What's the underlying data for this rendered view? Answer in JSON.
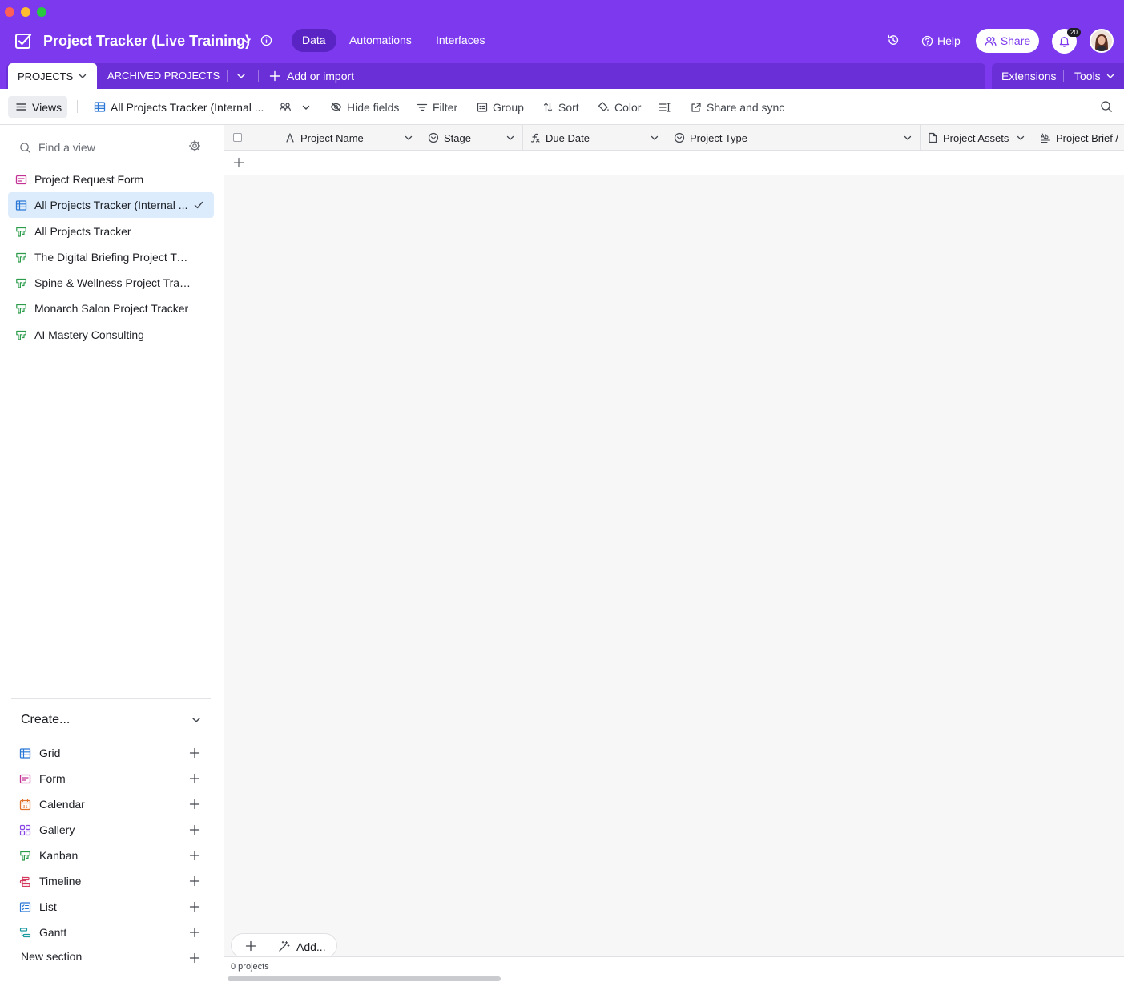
{
  "base": {
    "title": "Project Tracker (Live Training)",
    "brand_color": "#7c39ed"
  },
  "top_tabs": [
    "Data",
    "Automations",
    "Interfaces"
  ],
  "header_actions": {
    "help": "Help",
    "share": "Share",
    "notifications_count": "20"
  },
  "tables": {
    "active": "PROJECTS",
    "other": "ARCHIVED PROJECTS",
    "add_import": "Add or import",
    "extensions": "Extensions",
    "tools": "Tools"
  },
  "toolbar": {
    "views": "Views",
    "current_view": "All Projects Tracker (Internal ...",
    "hide_fields": "Hide fields",
    "filter": "Filter",
    "group": "Group",
    "sort": "Sort",
    "color": "Color",
    "share_sync": "Share and sync"
  },
  "sidebar": {
    "find_placeholder": "Find a view",
    "views": [
      {
        "label": "Project Request Form",
        "icon": "form-icon",
        "active": false
      },
      {
        "label": "All Projects Tracker (Internal ...",
        "icon": "grid-icon",
        "active": true
      },
      {
        "label": "All Projects Tracker",
        "icon": "kanban-icon",
        "active": false
      },
      {
        "label": "The Digital Briefing Project Tracker",
        "icon": "kanban-icon",
        "active": false
      },
      {
        "label": "Spine & Wellness Project Tracker",
        "icon": "kanban-icon",
        "active": false
      },
      {
        "label": "Monarch Salon Project Tracker",
        "icon": "kanban-icon",
        "active": false
      },
      {
        "label": "AI Mastery Consulting",
        "icon": "kanban-icon",
        "active": false
      }
    ],
    "create_title": "Create...",
    "create_items": [
      "Grid",
      "Form",
      "Calendar",
      "Gallery",
      "Kanban",
      "Timeline",
      "List",
      "Gantt"
    ],
    "new_section": "New section"
  },
  "grid": {
    "columns": [
      "Project Name",
      "Stage",
      "Due Date",
      "Project Type",
      "Project Assets",
      "Project Brief /"
    ],
    "record_count": "0 projects",
    "add_label": "Add..."
  }
}
